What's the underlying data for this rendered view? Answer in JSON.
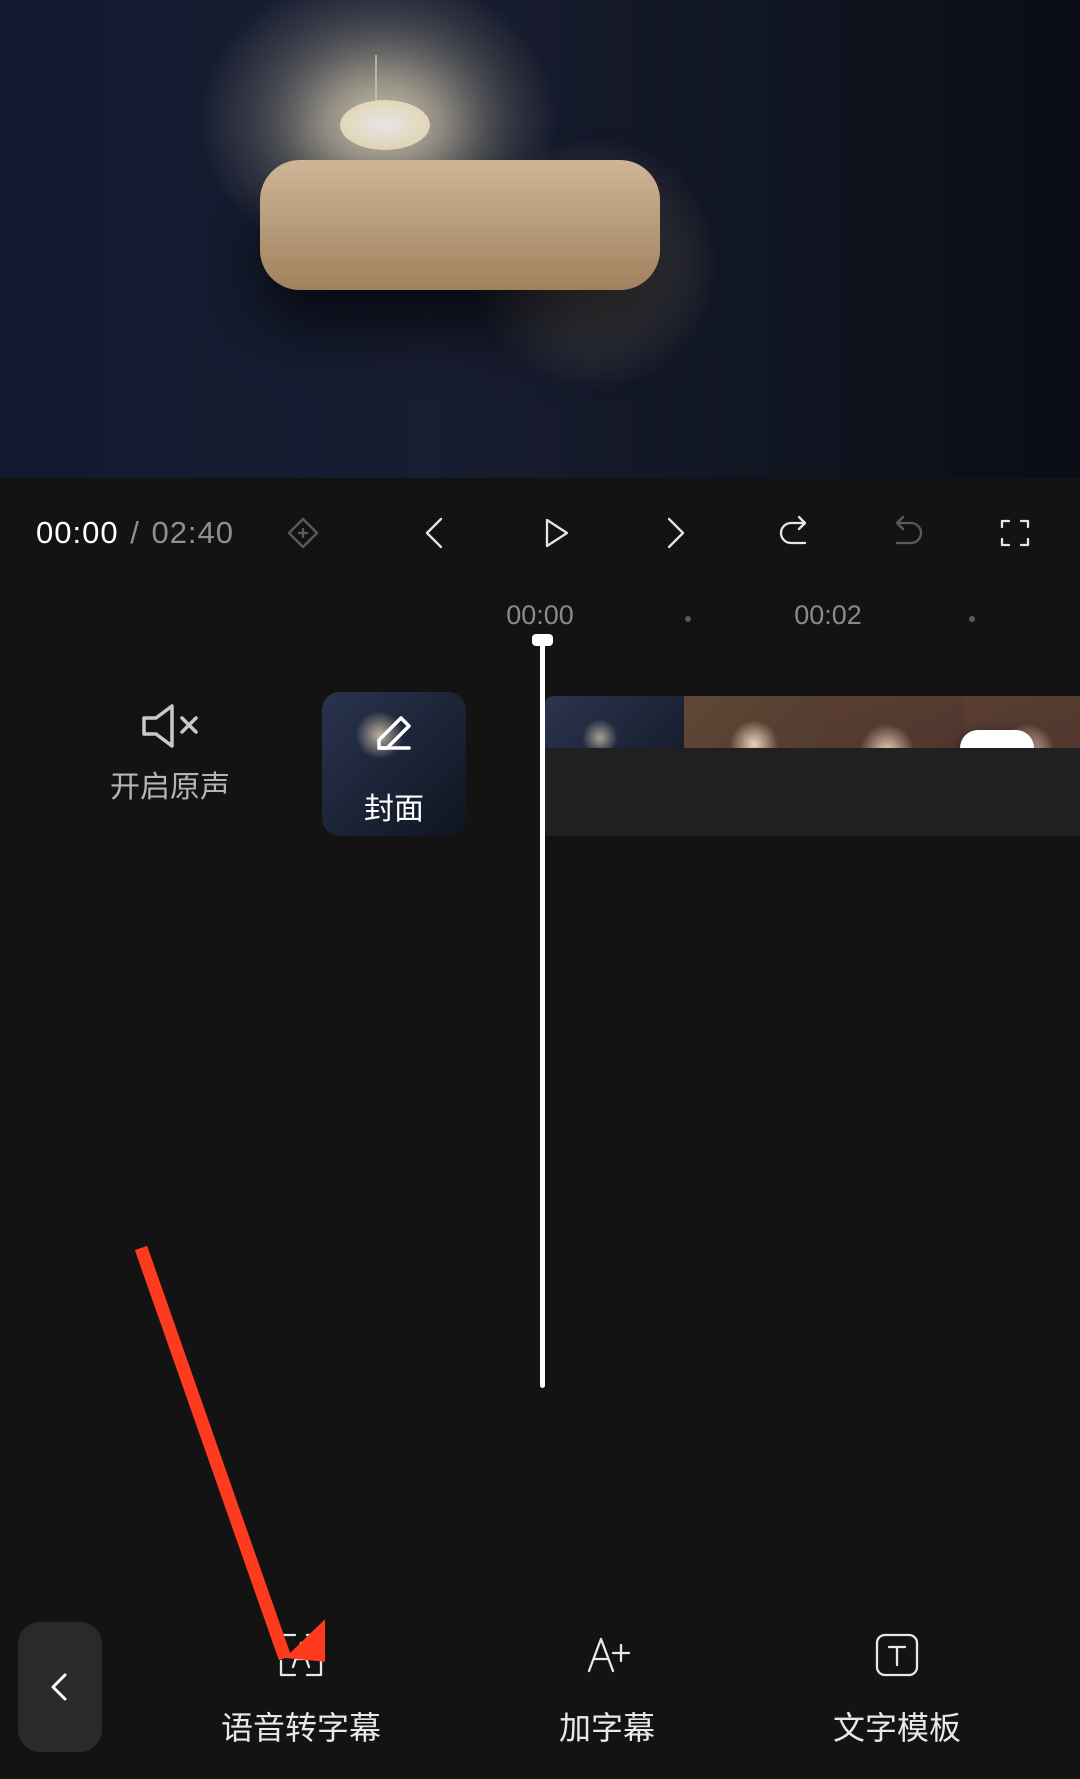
{
  "playback": {
    "current_time": "00:00",
    "separator": "/",
    "duration": "02:40"
  },
  "ruler": {
    "t0": "00:00",
    "t1": "00:02"
  },
  "sound_toggle_label": "开启原声",
  "cover_label": "封面",
  "tools": {
    "speech_to_subtitle": "语音转字幕",
    "add_subtitle": "加字幕",
    "text_template": "文字模板"
  }
}
